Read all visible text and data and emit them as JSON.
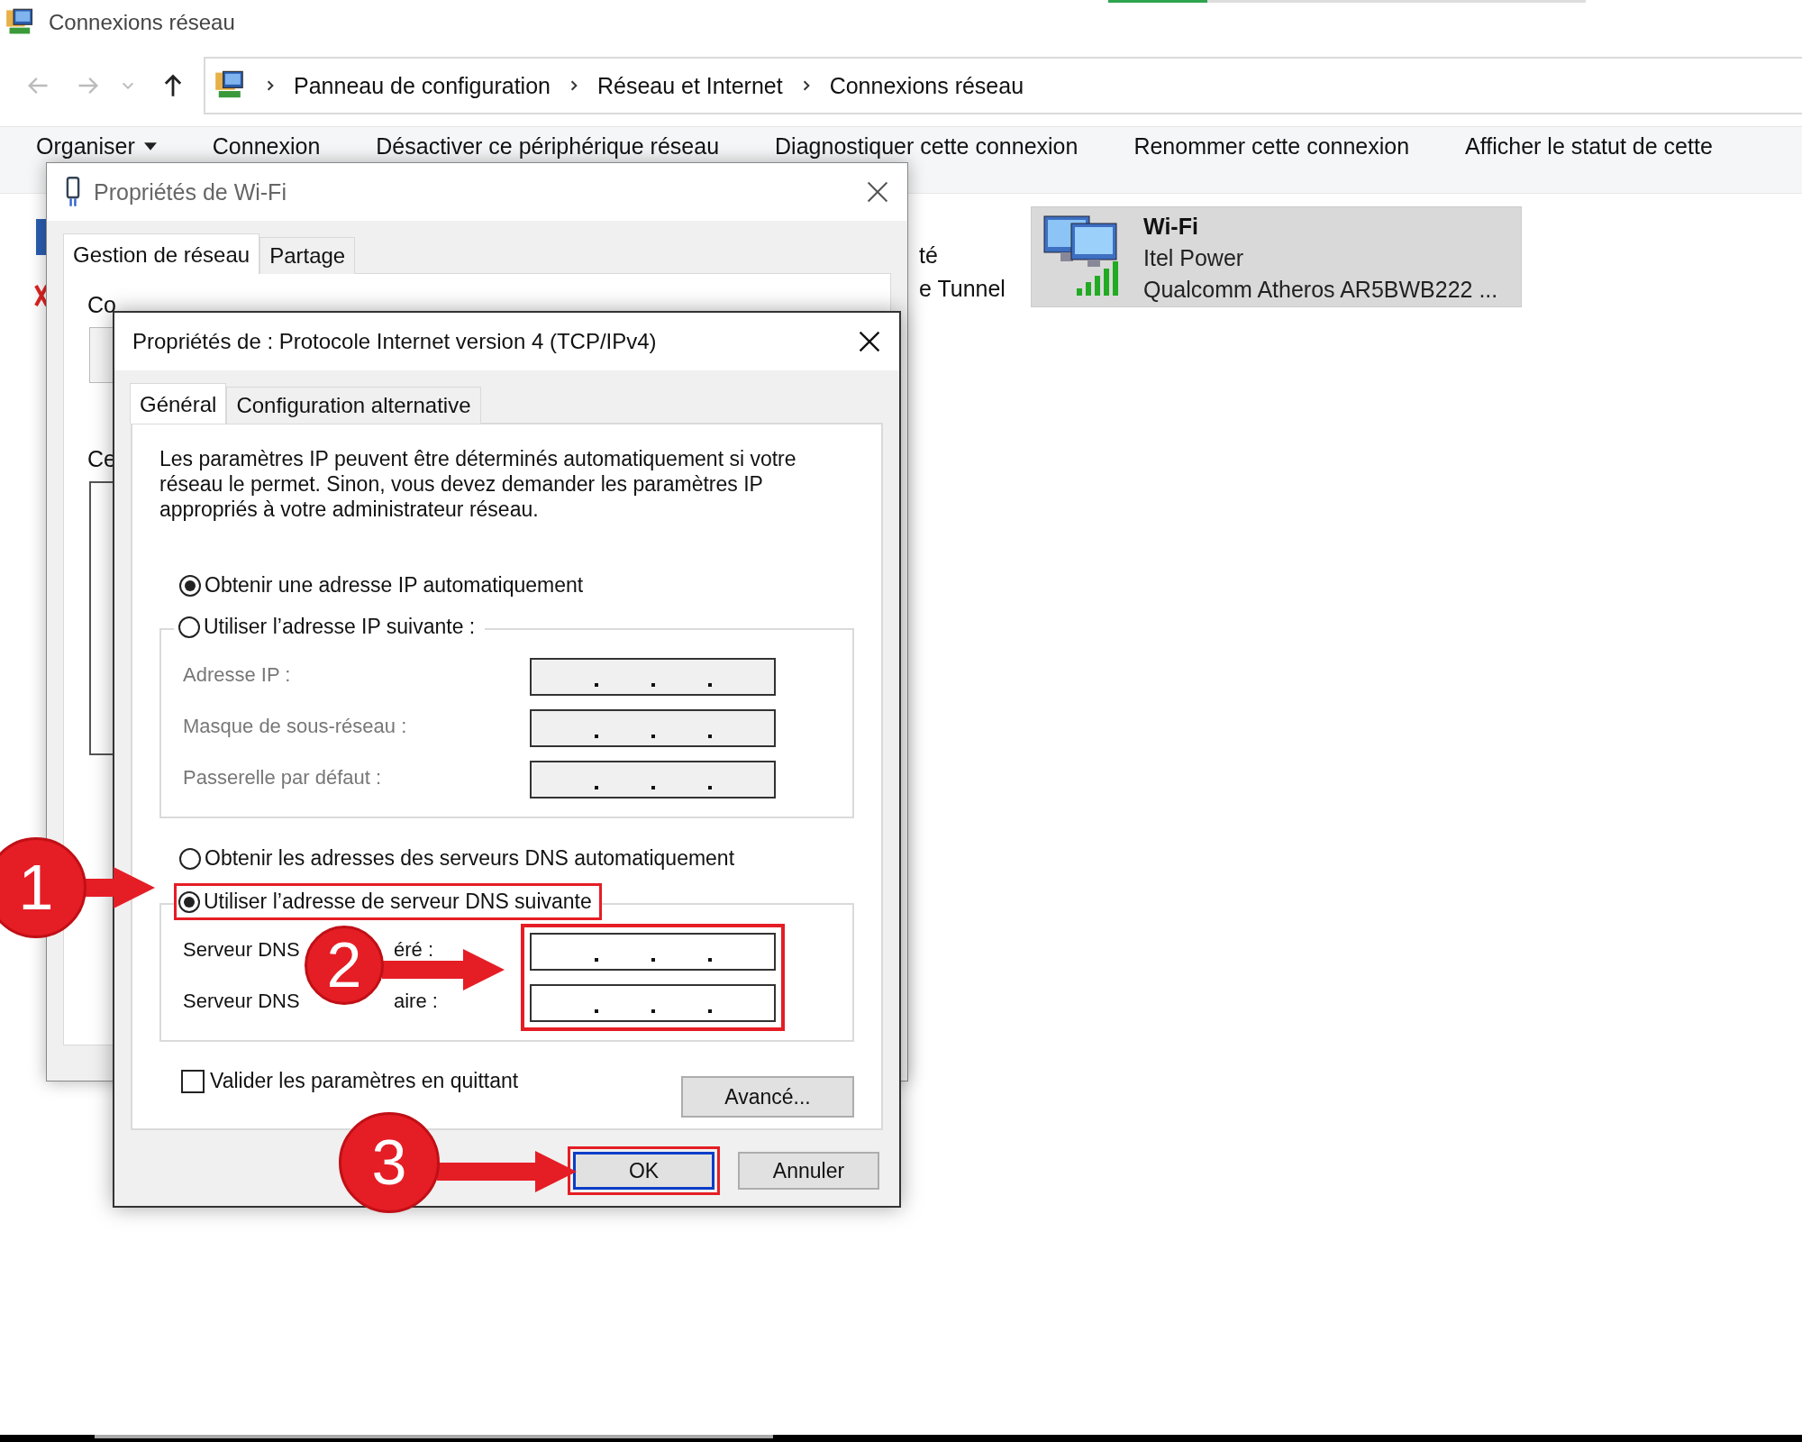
{
  "explorer": {
    "title": "Connexions réseau",
    "breadcrumb": [
      "Panneau de configuration",
      "Réseau et Internet",
      "Connexions réseau"
    ],
    "toolbar": [
      {
        "label": "Organiser",
        "kind": "menu"
      },
      {
        "label": "Connexion",
        "kind": "command"
      },
      {
        "label": "Désactiver ce périphérique réseau",
        "kind": "command"
      },
      {
        "label": "Diagnostiquer cette connexion",
        "kind": "command"
      },
      {
        "label": "Renommer cette connexion",
        "kind": "command"
      },
      {
        "label": "Afficher le statut de cette",
        "kind": "command"
      }
    ],
    "hidden_item_texts": [
      "té",
      "e Tunnel"
    ],
    "connection": {
      "name": "Wi-Fi",
      "network": "Itel Power",
      "adapter": "Qualcomm Atheros AR5BWB222 ...",
      "selected": true
    }
  },
  "wifi_dialog": {
    "title": "Propriétés de Wi-Fi",
    "tabs": [
      {
        "label": "Gestion de réseau",
        "selected": true
      },
      {
        "label": "Partage",
        "selected": false
      }
    ],
    "labels": [
      "Co",
      "Ce"
    ]
  },
  "tcp_dialog": {
    "title": "Propriétés de : Protocole Internet version 4 (TCP/IPv4)",
    "tabs": [
      {
        "label": "Général",
        "selected": true
      },
      {
        "label": "Configuration alternative",
        "selected": false
      }
    ],
    "description": "Les paramètres IP peuvent être déterminés automatiquement si votre réseau le permet. Sinon, vous devez demander les paramètres IP appropriés à votre administrateur réseau.",
    "ip_options": [
      {
        "label": "Obtenir une adresse IP automatiquement",
        "selected": true,
        "highlighted": false
      },
      {
        "label": "Utiliser l’adresse IP suivante :",
        "selected": false,
        "highlighted": false
      }
    ],
    "ip_fields": {
      "disabled": true,
      "highlighted": false,
      "items": [
        {
          "label": "Adresse IP :"
        },
        {
          "label": "Masque de sous-réseau :"
        },
        {
          "label": "Passerelle par défaut :"
        }
      ]
    },
    "dns_options": [
      {
        "label": "Obtenir les adresses des serveurs DNS automatiquement",
        "selected": false,
        "highlighted": false
      },
      {
        "label": "Utiliser l’adresse de serveur DNS suivante",
        "selected": true,
        "highlighted": true
      }
    ],
    "dns_fields": {
      "disabled": false,
      "highlighted": true,
      "items": [
        {
          "label": "Serveur DNS",
          "label_end": "éré :"
        },
        {
          "label": "Serveur DNS",
          "label_end": "aire :"
        }
      ]
    },
    "validate": {
      "label": "Valider les paramètres en quittant",
      "checked": false
    },
    "advanced_button": "Avancé...",
    "buttons": [
      {
        "label": "OK",
        "default": true,
        "highlighted": true
      },
      {
        "label": "Annuler",
        "default": false,
        "highlighted": false
      }
    ]
  },
  "steps": [
    {
      "number": "1"
    },
    {
      "number": "2"
    },
    {
      "number": "3"
    }
  ]
}
